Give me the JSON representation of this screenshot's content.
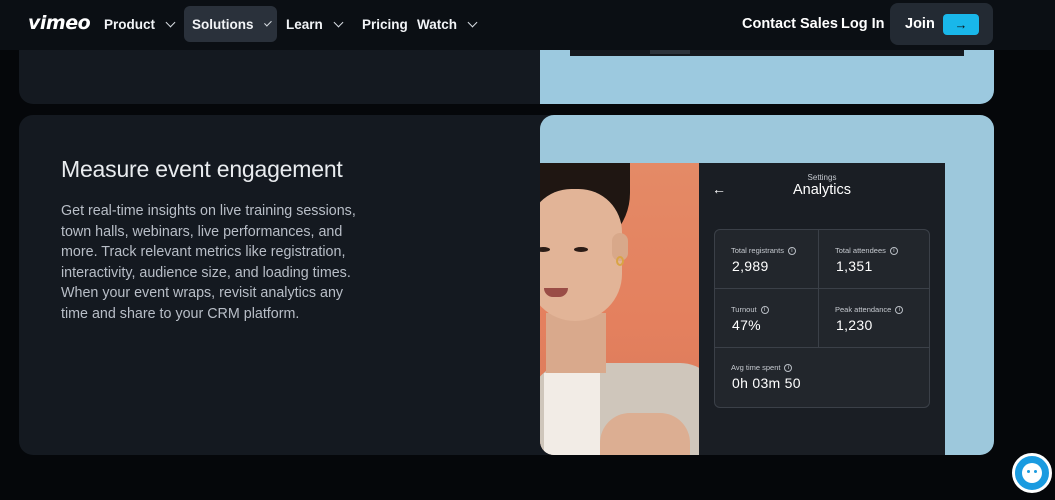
{
  "nav": {
    "logo": "vimeo",
    "items": [
      {
        "label": "Product"
      },
      {
        "label": "Solutions"
      },
      {
        "label": "Learn"
      },
      {
        "label": "Pricing"
      },
      {
        "label": "Watch"
      }
    ],
    "contact_sales": "Contact Sales",
    "log_in": "Log In",
    "join": "Join",
    "join_arrow": "→",
    "accent": "#19b7ea"
  },
  "feature": {
    "title": "Measure event engagement",
    "description": "Get real-time insights on live training sessions, town halls, webinars, live performances, and more. Track relevant metrics like registration, interactivity, audience size, and loading times. When your event wraps, revisit analytics any time and share to your CRM platform."
  },
  "analytics": {
    "settings_label": "Settings",
    "title": "Analytics",
    "back_icon": "←",
    "metrics": [
      {
        "label": "Total registrants",
        "value": "2,989"
      },
      {
        "label": "Total attendees",
        "value": "1,351"
      },
      {
        "label": "Turnout",
        "value": "47%"
      },
      {
        "label": "Peak attendance",
        "value": "1,230"
      },
      {
        "label": "Avg time spent",
        "value": "0h 03m 50"
      }
    ]
  },
  "assistant": {
    "icon": "assistant-icon"
  }
}
